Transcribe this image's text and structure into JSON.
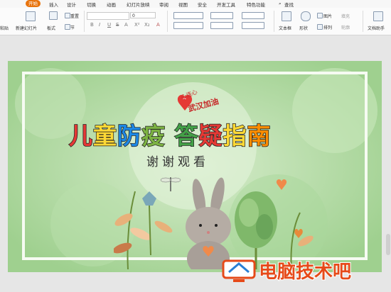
{
  "menubar": {
    "tabs": [
      "开始",
      "插入",
      "设计",
      "切换",
      "动画",
      "幻灯片放映",
      "审阅",
      "视图",
      "安全",
      "开发工具",
      "特色功能"
    ],
    "active": "开始",
    "search": "查找"
  },
  "ribbon": {
    "new_slide": "新建幻灯片",
    "layout": "板式",
    "reset": "重置",
    "section": "节",
    "font_size": "0",
    "format_buttons": [
      "B",
      "I",
      "U",
      "S",
      "A",
      "X²",
      "X₂",
      "A"
    ],
    "textbox": "文本框",
    "shape": "形状",
    "picture": "图片",
    "arrange": "排列",
    "fill": "填充",
    "outline": "轮廓",
    "assistant": "文档助手",
    "left_stub": "粘贴"
  },
  "slide": {
    "badge_text": "武汉加油",
    "badge_small": "心连心",
    "title_chars": [
      {
        "ch": "儿",
        "color": "#e53935"
      },
      {
        "ch": "童",
        "color": "#fdd835"
      },
      {
        "ch": "防",
        "color": "#1e88e5"
      },
      {
        "ch": "疫",
        "color": "#7cb342"
      },
      {
        "ch": " ",
        "color": "#000000"
      },
      {
        "ch": "答",
        "color": "#43a047"
      },
      {
        "ch": "疑",
        "color": "#e53935"
      },
      {
        "ch": "指",
        "color": "#fdd835"
      },
      {
        "ch": "南",
        "color": "#fb8c00"
      }
    ],
    "subtitle": "谢谢观看"
  },
  "watermark": {
    "text": "电脑技术吧",
    "color": "#e64a19"
  }
}
